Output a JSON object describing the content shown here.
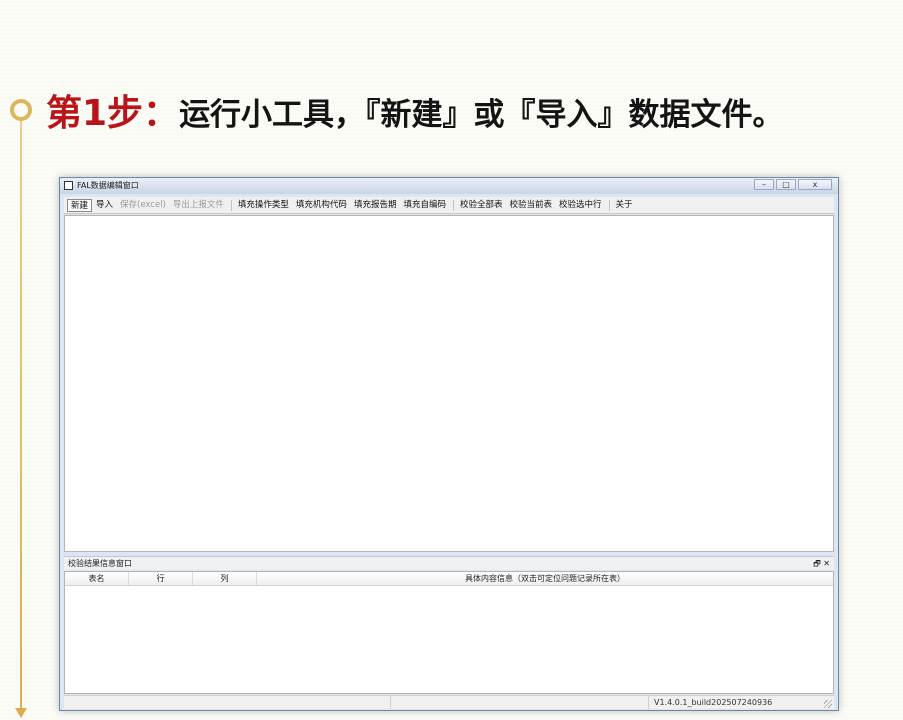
{
  "headline": {
    "step": "第1步：",
    "text": "运行小工具，『新建』或『导入』数据文件。"
  },
  "window": {
    "title": "FAL数据编辑窗口",
    "controls": [
      "–",
      "□",
      "x"
    ]
  },
  "menu": [
    {
      "label": "新建",
      "state": "pressed"
    },
    {
      "label": "导入",
      "state": "normal"
    },
    {
      "label": "保存(excel)",
      "state": "disabled"
    },
    {
      "label": "导出上报文件",
      "state": "disabled"
    },
    {
      "label": "填充操作类型",
      "state": "normal"
    },
    {
      "label": "填充机构代码",
      "state": "normal"
    },
    {
      "label": "填充报告期",
      "state": "normal"
    },
    {
      "label": "填充自编码",
      "state": "normal"
    },
    {
      "label": "校验全部表",
      "state": "normal"
    },
    {
      "label": "校验当前表",
      "state": "normal"
    },
    {
      "label": "校验选中行",
      "state": "normal"
    },
    {
      "label": "关于",
      "state": "normal"
    }
  ],
  "results_panel": {
    "title": "校验结果信息窗口",
    "buttons": [
      "🗗",
      "✕"
    ],
    "columns": [
      "表名",
      "行",
      "列",
      "具体内容信息（双击可定位问题记录所在表）"
    ]
  },
  "status": {
    "version": "V1.4.0.1_build202507240936"
  },
  "colors": {
    "step_label": "#b8141a",
    "timeline": "#d9ae4d",
    "window_frame": "#dbe6f3"
  }
}
